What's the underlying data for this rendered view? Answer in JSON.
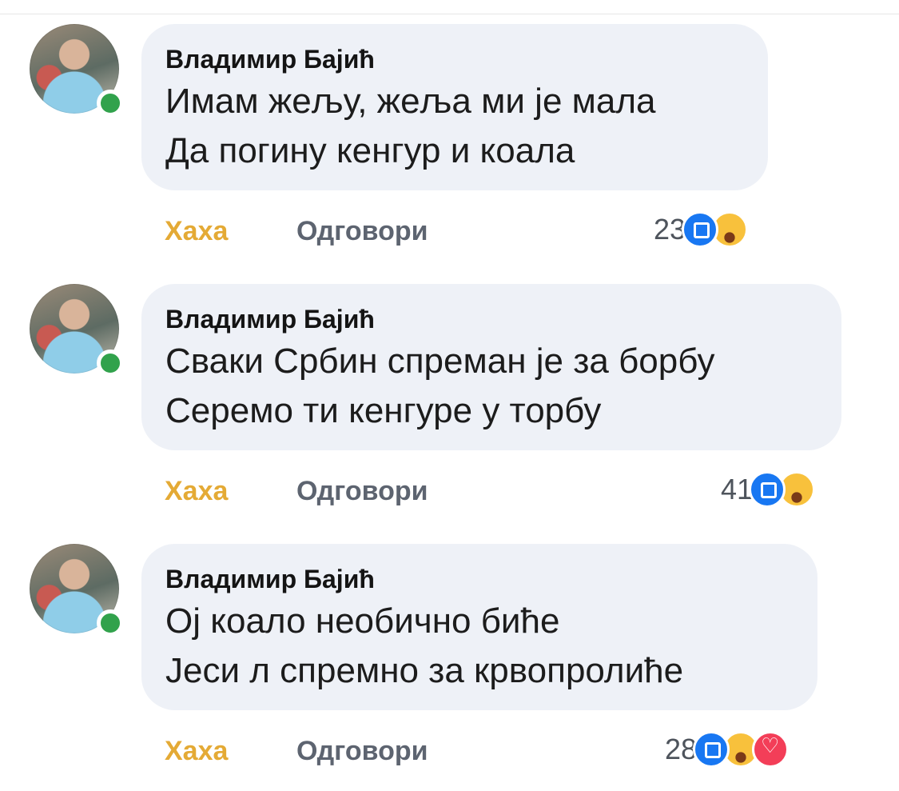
{
  "comments": [
    {
      "author": "Владимир Бајић",
      "lines": [
        "Имам жељу, жеља ми је мала",
        "Да погину кенгур и коала"
      ],
      "haha_label": "Хаха",
      "reply_label": "Одговори",
      "reaction_count": "23",
      "reactions": [
        "like-icon",
        "laugh-icon"
      ]
    },
    {
      "author": "Владимир Бајић",
      "lines": [
        "Сваки Србин спреман је за борбу",
        "Серемо ти кенгуре у торбу"
      ],
      "haha_label": "Хаха",
      "reply_label": "Одговори",
      "reaction_count": "41",
      "reactions": [
        "like-icon",
        "laugh-icon"
      ]
    },
    {
      "author": "Владимир Бајић",
      "lines": [
        "Ој коало необично биће",
        "Јеси л спремно за крвопролиће"
      ],
      "haha_label": "Хаха",
      "reply_label": "Одговори",
      "reaction_count": "28",
      "reactions": [
        "like-icon",
        "laugh-icon",
        "love-icon"
      ]
    }
  ],
  "colors": {
    "bubble": "#eef1f7",
    "haha": "#e4aa35",
    "online": "#31a24c",
    "like": "#1877f2",
    "love": "#f33e58"
  }
}
